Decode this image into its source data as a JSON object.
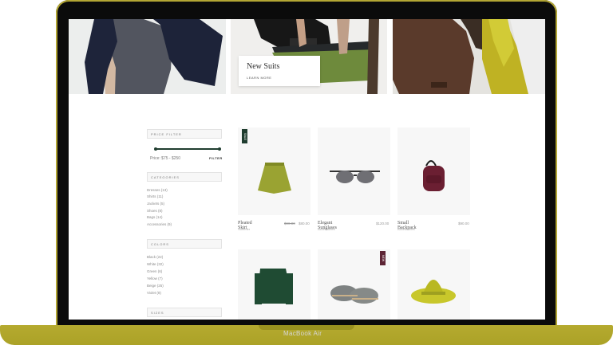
{
  "device": {
    "label": "MacBook Air"
  },
  "hero": {
    "promo": {
      "title": "New Suits",
      "link": "LEARN MORE"
    }
  },
  "sidebar": {
    "price_filter": {
      "title": "PRICE FILTER",
      "range_text": "Price: $75 - $250",
      "button": "FILTER"
    },
    "categories": {
      "title": "CATEGORIES",
      "items": [
        {
          "label": "Dresses (13)"
        },
        {
          "label": "Shirts (11)"
        },
        {
          "label": "Jackets (5)"
        },
        {
          "label": "Shoes (8)"
        },
        {
          "label": "Bags (14)"
        },
        {
          "label": "Accessories (9)"
        }
      ]
    },
    "colors": {
      "title": "COLORS",
      "items": [
        {
          "label": "Black (22)"
        },
        {
          "label": "White (32)"
        },
        {
          "label": "Green (6)"
        },
        {
          "label": "Yellow (7)"
        },
        {
          "label": "Beige (25)"
        },
        {
          "label": "Violet (8)"
        }
      ]
    },
    "sizes": {
      "title": "SIZES"
    }
  },
  "products": [
    {
      "name": "Pleated Skirt",
      "category": "Summer",
      "old_price": "$90.00",
      "price": "$80.00",
      "badge": "SALE",
      "badge_color": "#1f3d2f"
    },
    {
      "name": "Elegant Sunglases",
      "category": "Accessories",
      "price": "$120.00"
    },
    {
      "name": "Small Backpack",
      "category": "Accessories",
      "price": "$90.00"
    },
    {
      "name": "",
      "category": ""
    },
    {
      "name": "",
      "category": "",
      "badge": "NEW",
      "badge_color": "#5d2434"
    },
    {
      "name": "",
      "category": ""
    }
  ],
  "colors": {
    "accent": "#1f3d2f",
    "laptop_gold": "#b3a634",
    "bezel": "#0b0b0b"
  }
}
